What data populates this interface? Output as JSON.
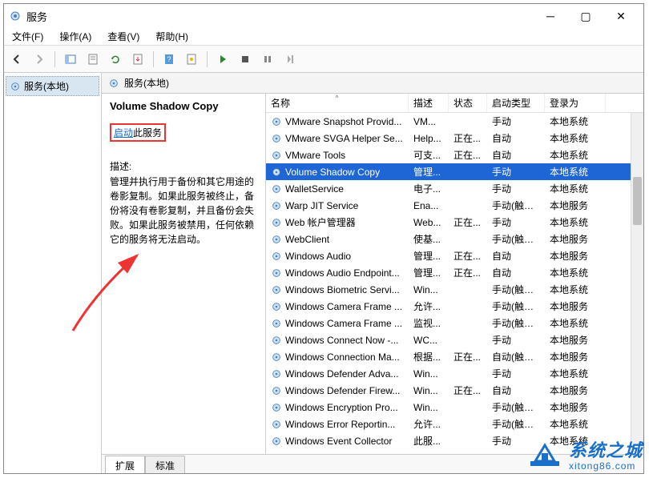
{
  "window": {
    "title": "服务"
  },
  "menus": {
    "file": "文件(F)",
    "action": "操作(A)",
    "view": "查看(V)",
    "help": "帮助(H)"
  },
  "tree": {
    "root": "服务(本地)"
  },
  "detail": {
    "header": "服务(本地)",
    "selected_title": "Volume Shadow Copy",
    "start_link": "启动",
    "start_link_suffix": "此服务",
    "desc_label": "描述:",
    "desc_text": "管理并执行用于备份和其它用途的卷影复制。如果此服务被终止，备份将没有卷影复制，并且备份会失败。如果此服务被禁用，任何依赖它的服务将无法启动。"
  },
  "columns": {
    "name": "名称",
    "desc": "描述",
    "status": "状态",
    "startup": "启动类型",
    "logon": "登录为"
  },
  "services": [
    {
      "name": "VMware Snapshot Provid...",
      "desc": "VM...",
      "status": "",
      "startup": "手动",
      "logon": "本地系统"
    },
    {
      "name": "VMware SVGA Helper Se...",
      "desc": "Help...",
      "status": "正在...",
      "startup": "自动",
      "logon": "本地系统"
    },
    {
      "name": "VMware Tools",
      "desc": "可支...",
      "status": "正在...",
      "startup": "自动",
      "logon": "本地系统"
    },
    {
      "name": "Volume Shadow Copy",
      "desc": "管理...",
      "status": "",
      "startup": "手动",
      "logon": "本地系统",
      "selected": true
    },
    {
      "name": "WalletService",
      "desc": "电子...",
      "status": "",
      "startup": "手动",
      "logon": "本地系统"
    },
    {
      "name": "Warp JIT Service",
      "desc": "Ena...",
      "status": "",
      "startup": "手动(触发...",
      "logon": "本地服务"
    },
    {
      "name": "Web 帐户管理器",
      "desc": "Web...",
      "status": "正在...",
      "startup": "手动",
      "logon": "本地系统"
    },
    {
      "name": "WebClient",
      "desc": "使基...",
      "status": "",
      "startup": "手动(触发...",
      "logon": "本地服务"
    },
    {
      "name": "Windows Audio",
      "desc": "管理...",
      "status": "正在...",
      "startup": "自动",
      "logon": "本地服务"
    },
    {
      "name": "Windows Audio Endpoint...",
      "desc": "管理...",
      "status": "正在...",
      "startup": "自动",
      "logon": "本地系统"
    },
    {
      "name": "Windows Biometric Servi...",
      "desc": "Win...",
      "status": "",
      "startup": "手动(触发...",
      "logon": "本地系统"
    },
    {
      "name": "Windows Camera Frame ...",
      "desc": "允许...",
      "status": "",
      "startup": "手动(触发...",
      "logon": "本地服务"
    },
    {
      "name": "Windows Camera Frame ...",
      "desc": "监视...",
      "status": "",
      "startup": "手动(触发...",
      "logon": "本地系统"
    },
    {
      "name": "Windows Connect Now -...",
      "desc": "WC...",
      "status": "",
      "startup": "手动",
      "logon": "本地服务"
    },
    {
      "name": "Windows Connection Ma...",
      "desc": "根据...",
      "status": "正在...",
      "startup": "自动(触发...",
      "logon": "本地服务"
    },
    {
      "name": "Windows Defender Adva...",
      "desc": "Win...",
      "status": "",
      "startup": "手动",
      "logon": "本地系统"
    },
    {
      "name": "Windows Defender Firew...",
      "desc": "Win...",
      "status": "正在...",
      "startup": "自动",
      "logon": "本地服务"
    },
    {
      "name": "Windows Encryption Pro...",
      "desc": "Win...",
      "status": "",
      "startup": "手动(触发...",
      "logon": "本地服务"
    },
    {
      "name": "Windows Error Reportin...",
      "desc": "允许...",
      "status": "",
      "startup": "手动(触发...",
      "logon": "本地系统"
    },
    {
      "name": "Windows Event Collector",
      "desc": "此服...",
      "status": "",
      "startup": "手动",
      "logon": "本地系统"
    }
  ],
  "tabs": {
    "extended": "扩展",
    "standard": "标准"
  },
  "watermark": {
    "name": "系统之城",
    "url": "xitong86.com"
  }
}
